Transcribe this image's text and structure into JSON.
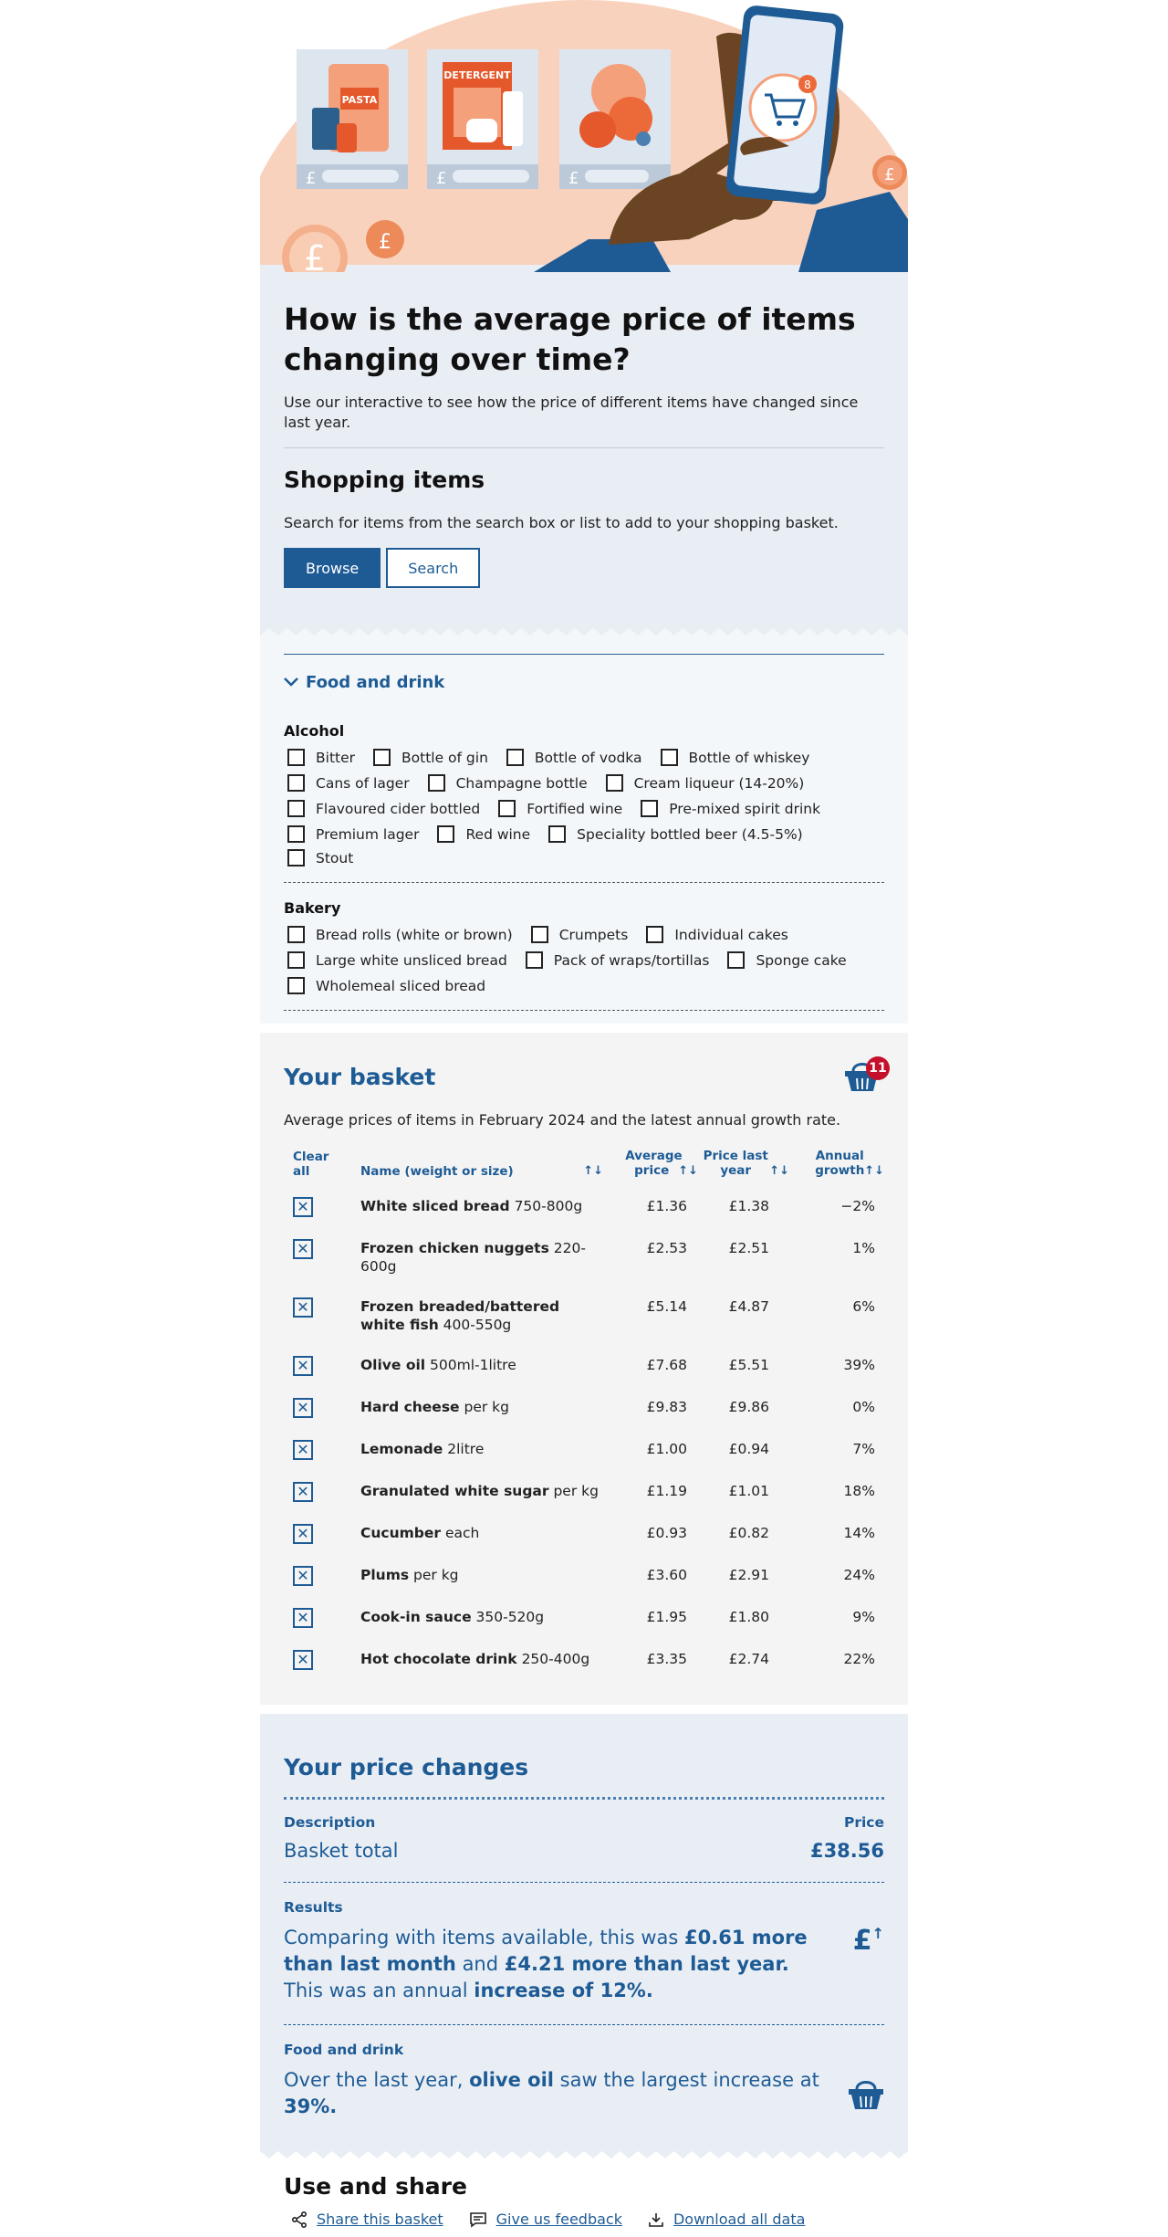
{
  "hero": {
    "pasta_label": "PASTA",
    "detergent_label": "DETERGENT",
    "cart_badge": "8",
    "pound_symbol": "£"
  },
  "intro": {
    "title": "How is the average price of items changing over time?",
    "description": "Use our interactive to see how the price of different items have changed since last year.",
    "section_title": "Shopping items",
    "hint": "Search for items from the search box or list to add to your shopping basket.",
    "browse_label": "Browse",
    "search_label": "Search"
  },
  "browse": {
    "accordion_label": "Food and drink",
    "categories": [
      {
        "title": "Alcohol",
        "rows": [
          [
            "Bitter",
            "Bottle of gin",
            "Bottle of vodka",
            "Bottle of whiskey"
          ],
          [
            "Cans of lager",
            "Champagne bottle",
            "Cream liqueur (14-20%)"
          ],
          [
            "Flavoured cider bottled",
            "Fortified wine",
            "Pre-mixed spirit drink"
          ],
          [
            "Premium lager",
            "Red wine",
            "Speciality bottled beer (4.5-5%)",
            "Stout"
          ]
        ]
      },
      {
        "title": "Bakery",
        "rows": [
          [
            "Bread rolls (white or brown)",
            "Crumpets",
            "Individual cakes"
          ],
          [
            "Large white unsliced bread",
            "Pack of wraps/tortillas",
            "Sponge cake"
          ],
          [
            "Wholemeal sliced bread"
          ]
        ]
      }
    ]
  },
  "basket": {
    "title": "Your basket",
    "count": "11",
    "subtitle": "Average prices of items in February 2024 and the latest annual growth rate.",
    "headers": {
      "clear": "Clear all",
      "name": "Name (weight or size)",
      "avg": "Average price",
      "last": "Price last year",
      "growth": "Annual growth"
    },
    "rows": [
      {
        "name": "White sliced bread",
        "size": "750-800g",
        "avg": "£1.36",
        "last": "£1.38",
        "growth": "−2%"
      },
      {
        "name": "Frozen chicken nuggets",
        "size": "220-600g",
        "avg": "£2.53",
        "last": "£2.51",
        "growth": "1%"
      },
      {
        "name": "Frozen breaded/battered white fish",
        "size": "400-550g",
        "avg": "£5.14",
        "last": "£4.87",
        "growth": "6%"
      },
      {
        "name": "Olive oil",
        "size": "500ml-1litre",
        "avg": "£7.68",
        "last": "£5.51",
        "growth": "39%"
      },
      {
        "name": "Hard cheese",
        "size": "per kg",
        "avg": "£9.83",
        "last": "£9.86",
        "growth": "0%"
      },
      {
        "name": "Lemonade",
        "size": "2litre",
        "avg": "£1.00",
        "last": "£0.94",
        "growth": "7%"
      },
      {
        "name": "Granulated white sugar",
        "size": "per kg",
        "avg": "£1.19",
        "last": "£1.01",
        "growth": "18%"
      },
      {
        "name": "Cucumber",
        "size": "each",
        "avg": "£0.93",
        "last": "£0.82",
        "growth": "14%"
      },
      {
        "name": "Plums",
        "size": "per kg",
        "avg": "£3.60",
        "last": "£2.91",
        "growth": "24%"
      },
      {
        "name": "Cook-in sauce",
        "size": "350-520g",
        "avg": "£1.95",
        "last": "£1.80",
        "growth": "9%"
      },
      {
        "name": "Hot chocolate drink",
        "size": "250-400g",
        "avg": "£3.35",
        "last": "£2.74",
        "growth": "22%"
      }
    ]
  },
  "changes": {
    "title": "Your price changes",
    "desc_label": "Description",
    "price_label": "Price",
    "total_label": "Basket total",
    "total_value": "£38.56",
    "results_label": "Results",
    "results_parts": [
      "Comparing with items available, this was ",
      "£0.61 more than last month",
      " and ",
      "£4.21 more than last year.",
      " This was an annual ",
      "increase of 12%."
    ],
    "food_label": "Food and drink",
    "food_parts": [
      "Over the last year, ",
      "olive oil",
      " saw the largest increase at ",
      "39%."
    ]
  },
  "use": {
    "title": "Use and share",
    "share": "Share this basket",
    "feedback": "Give us feedback",
    "download": "Download all data"
  },
  "colors": {
    "primary": "#1e5b95",
    "hero_peach": "#f9d2bd",
    "orange": "#ec8a5a",
    "badge_red": "#c5102c"
  }
}
